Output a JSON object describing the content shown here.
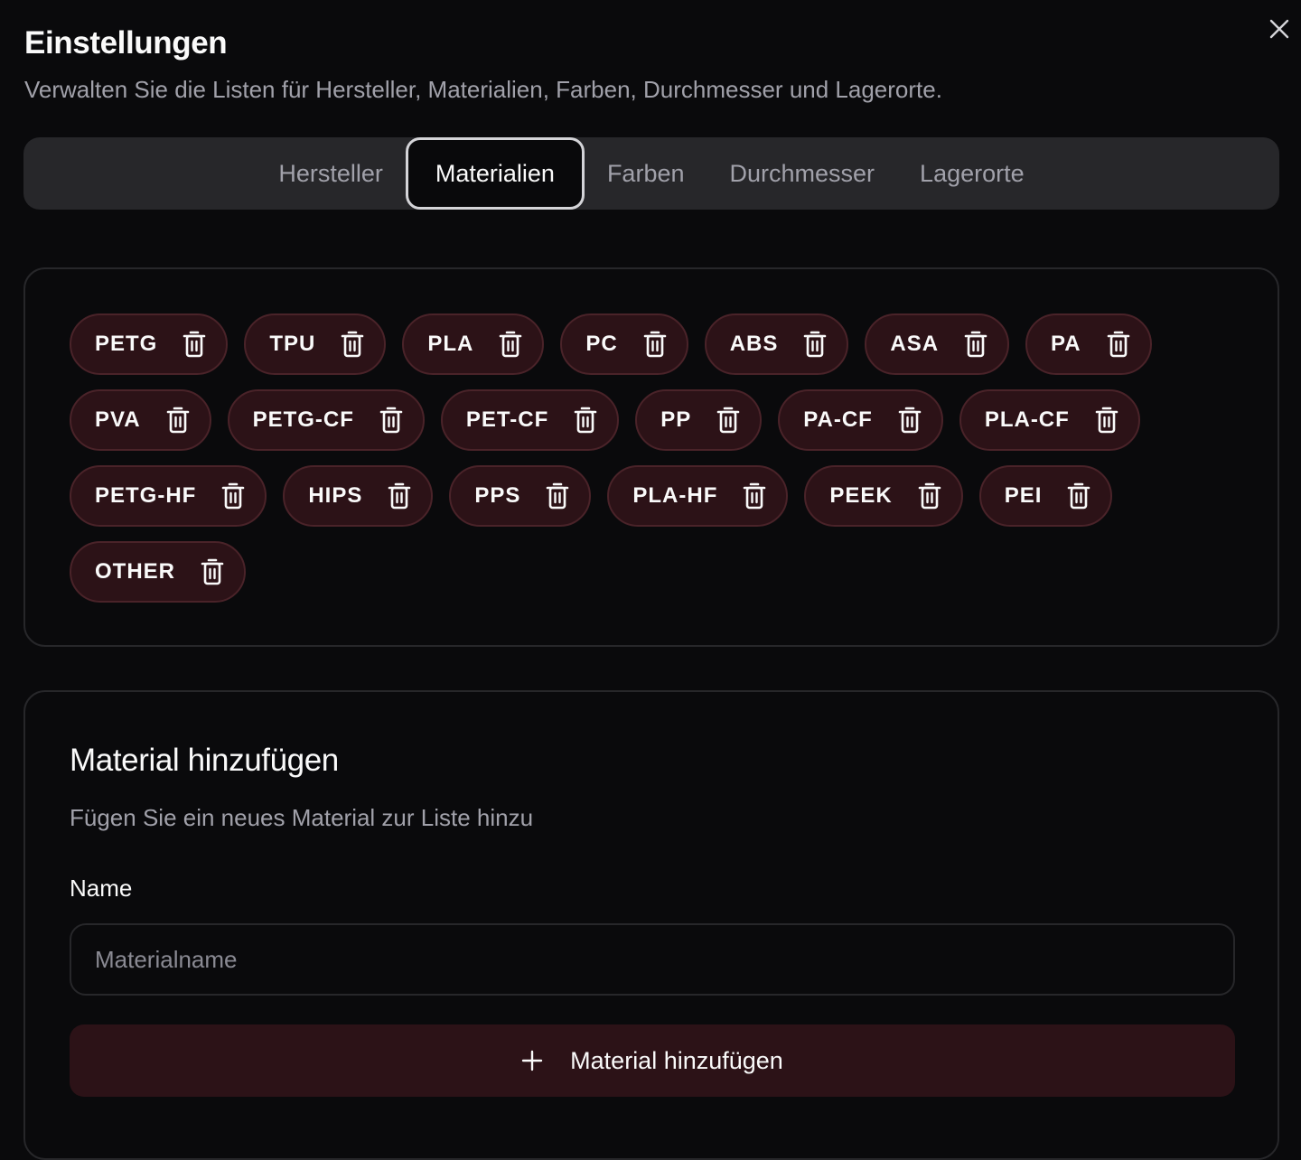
{
  "dialog": {
    "title": "Einstellungen",
    "subtitle": "Verwalten Sie die Listen für Hersteller, Materialien, Farben, Durchmesser und Lagerorte.",
    "close_icon": "close-icon"
  },
  "tabs": [
    {
      "label": "Hersteller",
      "active": false
    },
    {
      "label": "Materialien",
      "active": true
    },
    {
      "label": "Farben",
      "active": false
    },
    {
      "label": "Durchmesser",
      "active": false
    },
    {
      "label": "Lagerorte",
      "active": false
    }
  ],
  "materials": [
    "PETG",
    "TPU",
    "PLA",
    "PC",
    "ABS",
    "ASA",
    "PA",
    "PVA",
    "PETG-CF",
    "PET-CF",
    "PP",
    "PA-CF",
    "PLA-CF",
    "PETG-HF",
    "HIPS",
    "PPS",
    "PLA-HF",
    "PEEK",
    "PEI",
    "OTHER"
  ],
  "add_form": {
    "title": "Material hinzufügen",
    "description": "Fügen Sie ein neues Material zur Liste hinzu",
    "name_label": "Name",
    "name_placeholder": "Materialname",
    "name_value": "",
    "button_label": "Material hinzufügen"
  },
  "icons": {
    "chip_delete": "trash-icon",
    "add_button": "plus-icon"
  },
  "colors": {
    "background": "#0a0a0c",
    "chip_bg": "#2c1217",
    "chip_border": "#4a2329",
    "tab_bar_bg": "#27272a",
    "muted_text": "#a1a1aa"
  }
}
